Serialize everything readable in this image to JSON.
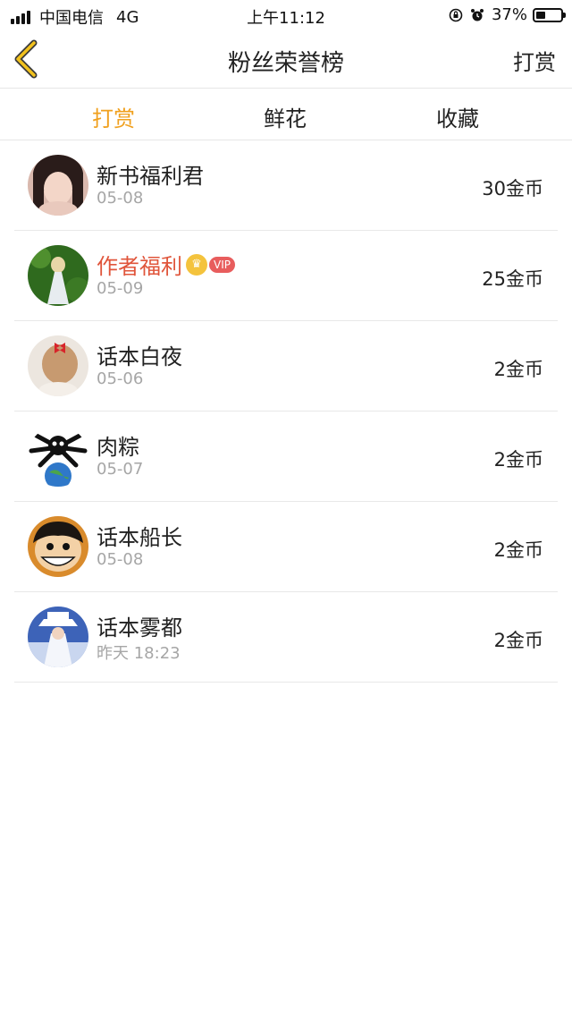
{
  "status_bar": {
    "carrier": "中国电信",
    "network": "4G",
    "time": "上午11:12",
    "battery_text": "37%",
    "battery_level": 0.37
  },
  "nav": {
    "title": "粉丝荣誉榜",
    "action_label": "打赏"
  },
  "tabs": [
    {
      "label": "打赏",
      "active": true
    },
    {
      "label": "鲜花",
      "active": false
    },
    {
      "label": "收藏",
      "active": false
    }
  ],
  "list": [
    {
      "name": "新书福利君",
      "date": "05-08",
      "amount": "30金币",
      "vip": false
    },
    {
      "name": "作者福利",
      "date": "05-09",
      "amount": "25金币",
      "vip": true,
      "vip_label": "VIP"
    },
    {
      "name": "话本白夜",
      "date": "05-06",
      "amount": "2金币",
      "vip": false
    },
    {
      "name": "肉粽",
      "date": "05-07",
      "amount": "2金币",
      "vip": false
    },
    {
      "name": "话本船长",
      "date": "05-08",
      "amount": "2金币",
      "vip": false
    },
    {
      "name": "话本雾都",
      "date": "昨天 18:23",
      "amount": "2金币",
      "vip": false
    }
  ],
  "colors": {
    "accent": "#f0a01e",
    "vip_name": "#e0553b",
    "vip_badge": "#e85d5d",
    "muted": "#a6a6a6"
  }
}
